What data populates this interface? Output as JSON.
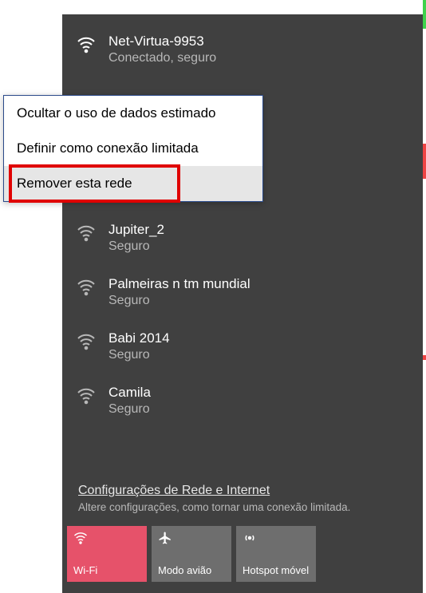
{
  "connected": {
    "name": "Net-Virtua-9953",
    "status": "Conectado, seguro"
  },
  "networks": [
    {
      "name": "Jupiter_2",
      "status": "Seguro"
    },
    {
      "name": "Palmeiras n tm mundial",
      "status": "Seguro"
    },
    {
      "name": "Babi 2014",
      "status": "Seguro"
    },
    {
      "name": "Camila",
      "status": "Seguro"
    }
  ],
  "context_menu": {
    "items": [
      "Ocultar o uso de dados estimado",
      "Definir como conexão limitada",
      "Remover esta rede"
    ]
  },
  "settings": {
    "link": "Configurações de Rede e Internet",
    "desc": "Altere configurações, como tornar uma conexão limitada."
  },
  "tiles": {
    "wifi": "Wi-Fi",
    "airplane": "Modo avião",
    "hotspot": "Hotspot móvel"
  }
}
